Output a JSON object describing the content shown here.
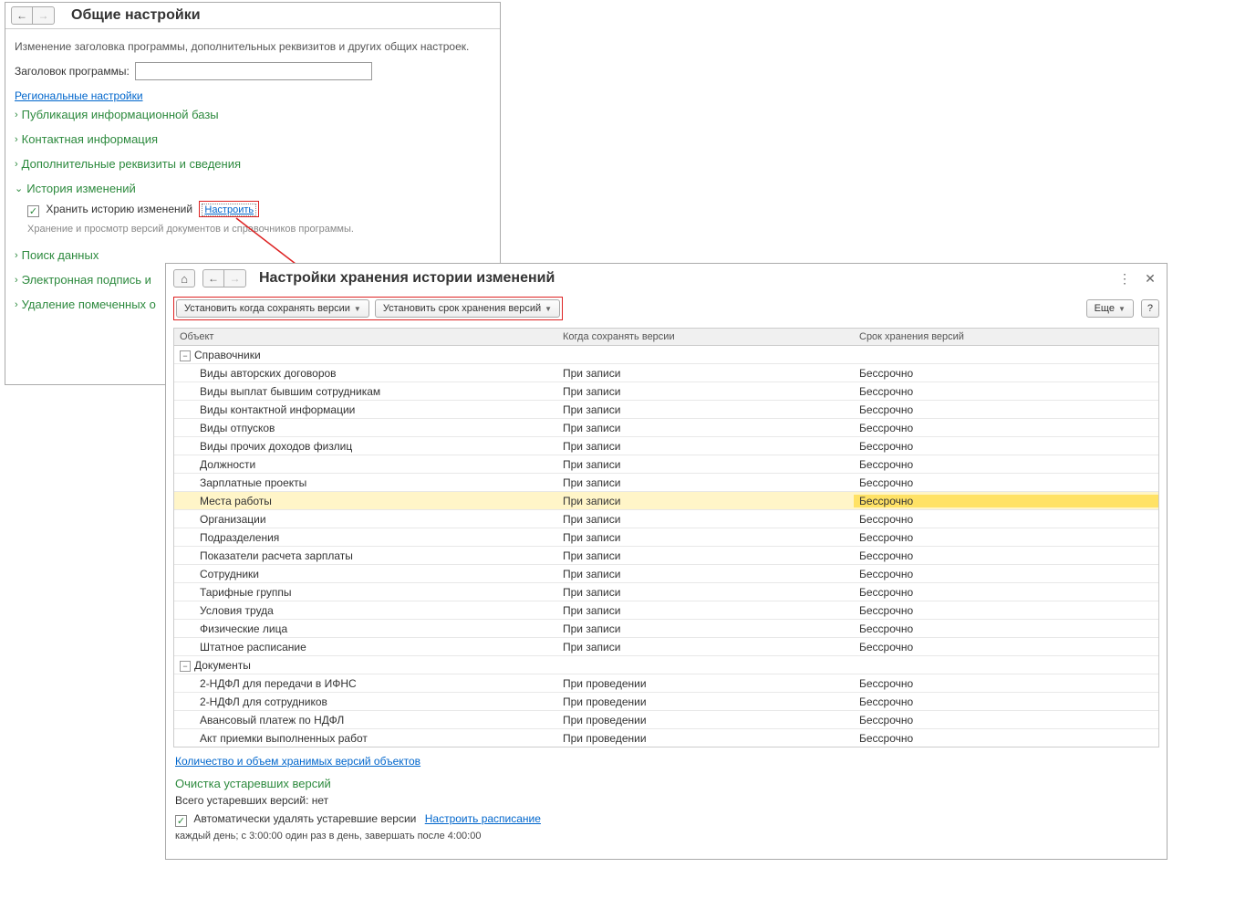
{
  "panel1": {
    "title": "Общие настройки",
    "description": "Изменение заголовка программы, дополнительных реквизитов и других общих настроек.",
    "program_title_label": "Заголовок программы:",
    "regional_link": "Региональные настройки",
    "sections": {
      "publication": "Публикация информационной базы",
      "contact": "Контактная информация",
      "additional": "Дополнительные реквизиты и сведения",
      "history": "История изменений",
      "history_checkbox": "Хранить историю изменений",
      "configure_link": "Настроить",
      "history_hint": "Хранение и просмотр версий документов и справочников программы.",
      "search": "Поиск данных",
      "signature": "Электронная подпись и",
      "delete": "Удаление помеченных о"
    }
  },
  "panel2": {
    "title": "Настройки хранения истории изменений",
    "toolbar": {
      "set_when": "Установить когда сохранять версии",
      "set_term": "Установить срок хранения версий",
      "more": "Еще",
      "help": "?"
    },
    "columns": {
      "object": "Объект",
      "when": "Когда сохранять версии",
      "term": "Срок хранения версий"
    },
    "groups": {
      "catalogs": "Справочники",
      "documents": "Документы"
    },
    "when_record": "При записи",
    "when_post": "При проведении",
    "term_forever": "Бессрочно",
    "catalog_rows": [
      "Виды авторских договоров",
      "Виды выплат бывшим сотрудникам",
      "Виды контактной информации",
      "Виды отпусков",
      "Виды прочих доходов физлиц",
      "Должности",
      "Зарплатные проекты",
      "Места работы",
      "Организации",
      "Подразделения",
      "Показатели расчета зарплаты",
      "Сотрудники",
      "Тарифные группы",
      "Условия труда",
      "Физические лица",
      "Штатное расписание"
    ],
    "document_rows": [
      "2-НДФЛ для передачи в ИФНС",
      "2-НДФЛ для сотрудников",
      "Авансовый платеж по НДФЛ",
      "Акт приемки выполненных работ"
    ],
    "footer": {
      "count_link": "Количество и объем хранимых версий объектов",
      "cleanup_title": "Очистка устаревших версий",
      "total_old": "Всего устаревших версий: нет",
      "auto_delete": "Автоматически удалять устаревшие версии",
      "schedule_link": "Настроить расписание",
      "schedule_text": "каждый день; с 3:00:00 один раз в день, завершать после 4:00:00"
    }
  }
}
